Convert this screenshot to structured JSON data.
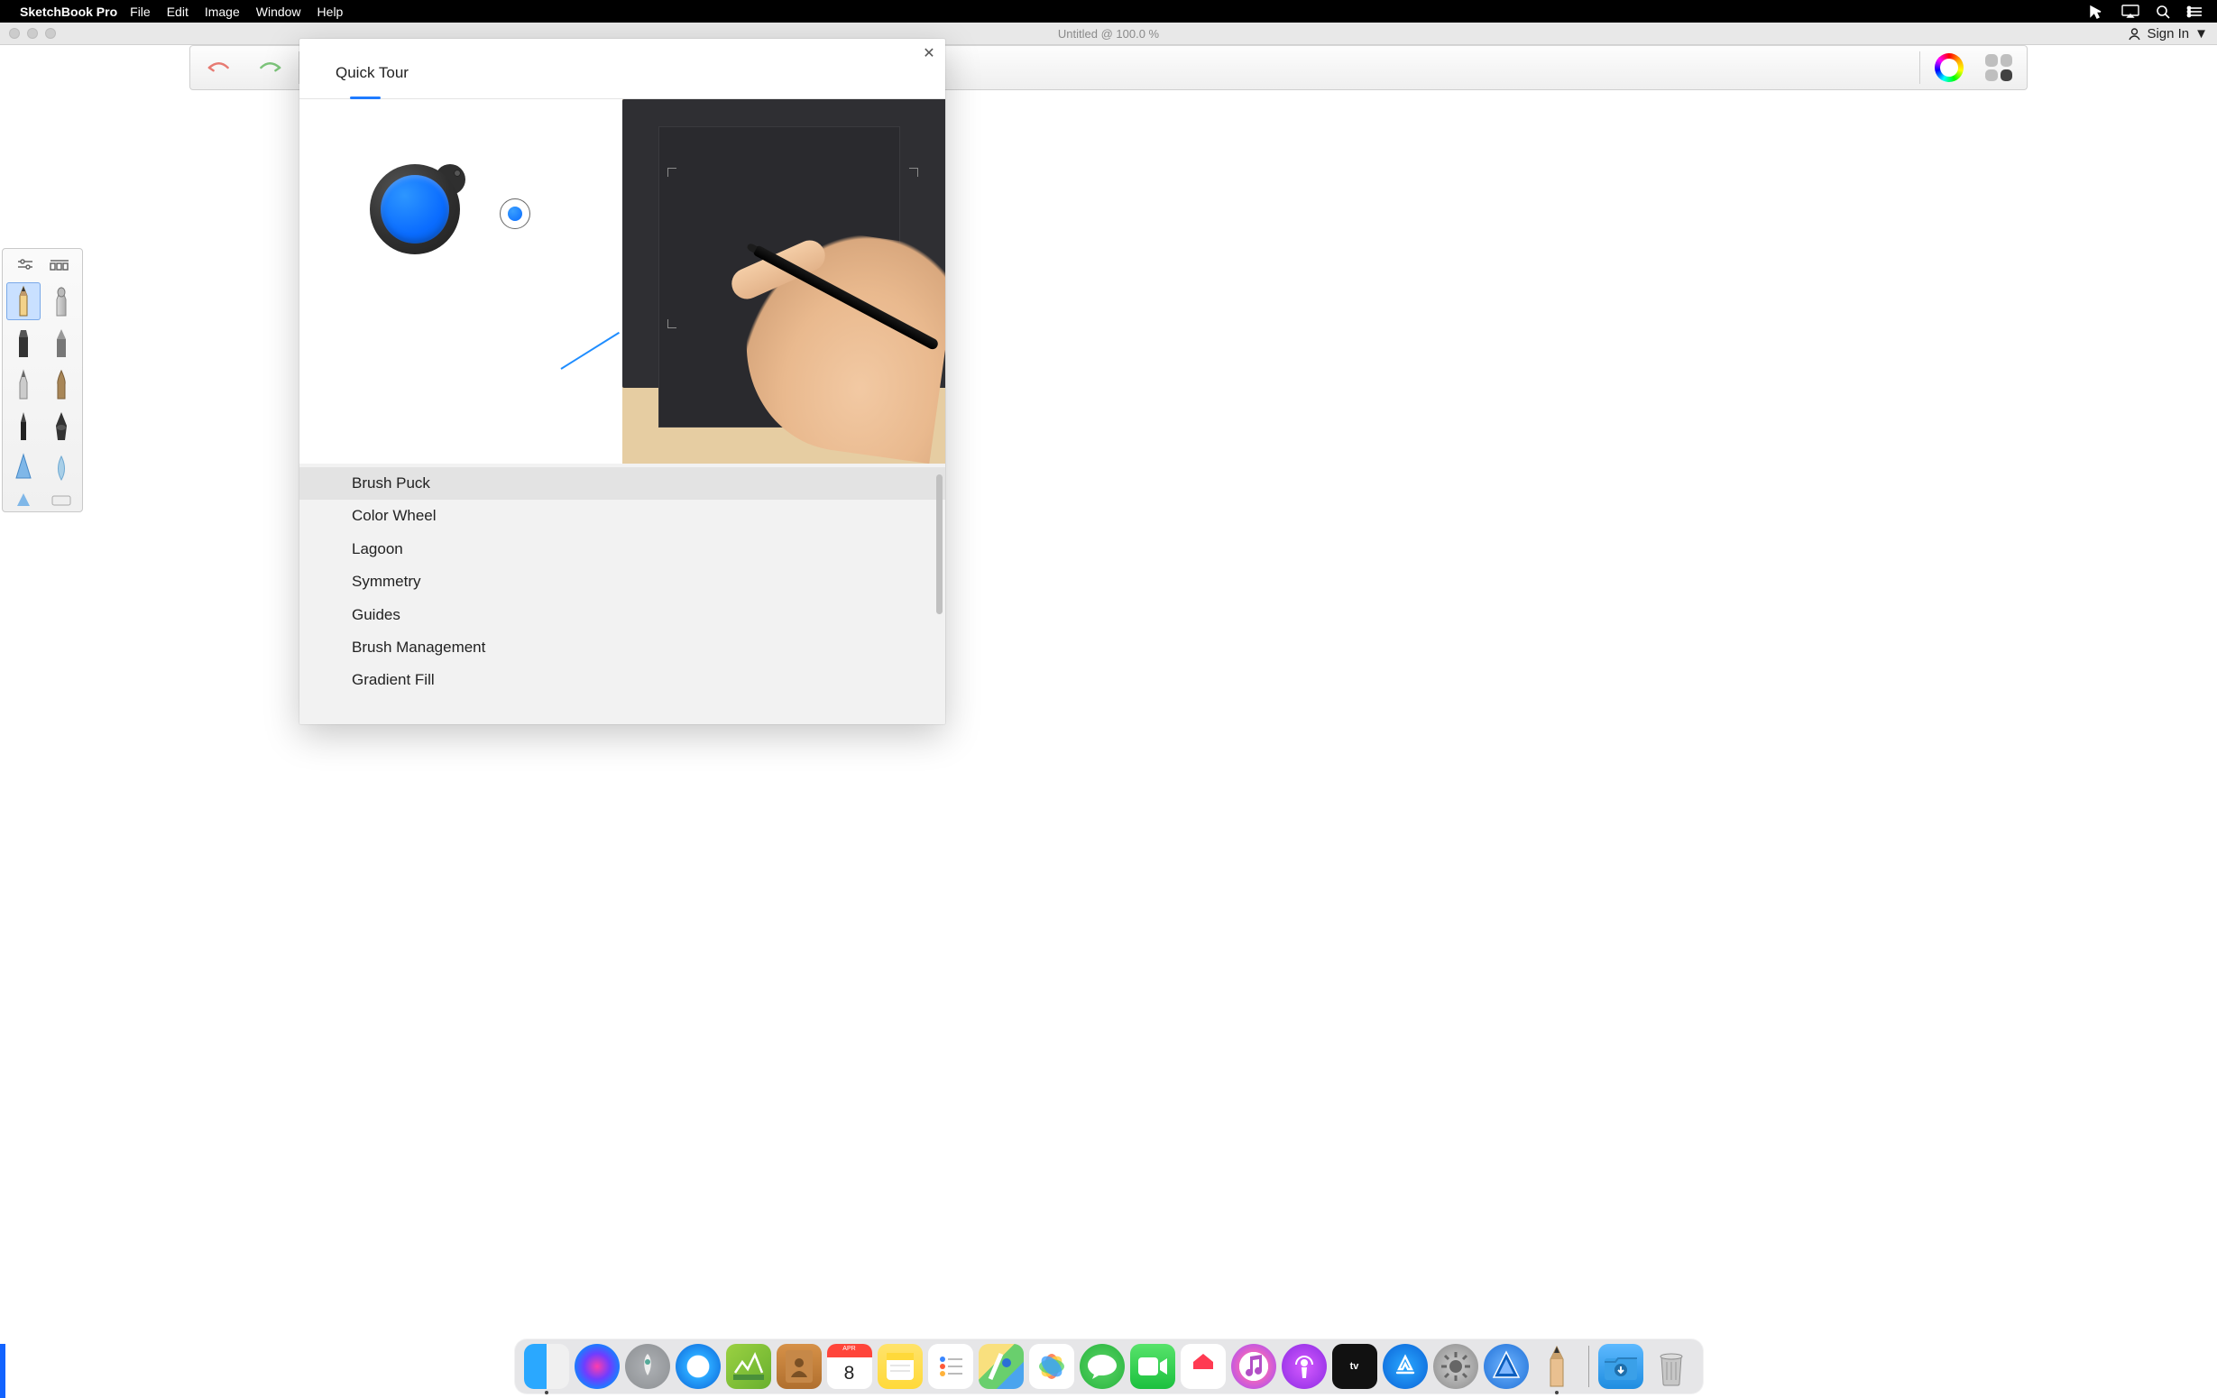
{
  "menubar": {
    "app_name": "SketchBook Pro",
    "menus": [
      "File",
      "Edit",
      "Image",
      "Window",
      "Help"
    ]
  },
  "window": {
    "title": "Untitled @ 100.0 %",
    "sign_in": "Sign In"
  },
  "quick_tour": {
    "header": "Quick Tour",
    "items": [
      "Brush Puck",
      "Color Wheel",
      "Lagoon",
      "Symmetry",
      "Guides",
      "Brush Management",
      "Gradient Fill"
    ],
    "selected_index": 0
  },
  "calendar": {
    "month": "APR",
    "day": "8"
  },
  "dock": {
    "apps": [
      "finder",
      "siri",
      "launchpad",
      "safari",
      "activity-monitor",
      "contacts",
      "calendar",
      "notes",
      "reminders",
      "maps",
      "photos",
      "messages",
      "facetime",
      "news",
      "music",
      "podcasts",
      "tv",
      "app-store",
      "system-preferences",
      "xcode",
      "sketchbook"
    ],
    "pinned": [
      "downloads",
      "trash"
    ]
  }
}
